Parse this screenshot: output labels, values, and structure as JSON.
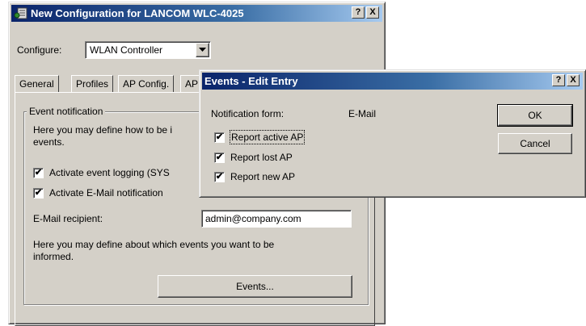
{
  "main_window": {
    "title": "New Configuration for LANCOM WLC-4025",
    "help_btn": "?",
    "close_btn": "X",
    "configure_label": "Configure:",
    "configure_value": "WLAN Controller",
    "tabs": [
      {
        "label": "General"
      },
      {
        "label": "Profiles"
      },
      {
        "label": "AP Config."
      },
      {
        "label": "AP"
      }
    ],
    "group_title": "Event notification",
    "desc1_line1": "Here you may define how to be i",
    "desc1_line2": "events.",
    "checkboxes": [
      {
        "label": "Activate event logging (SYS",
        "checked": true
      },
      {
        "label": "Activate E-Mail notification",
        "checked": true
      }
    ],
    "email_label": "E-Mail recipient:",
    "email_value": "admin@company.com",
    "desc2_line1": "Here you may define about which events you want to be",
    "desc2_line2": "informed.",
    "events_button": "Events..."
  },
  "dialog": {
    "title": "Events - Edit Entry",
    "help_btn": "?",
    "close_btn": "X",
    "notification_label": "Notification form:",
    "notification_value": "E-Mail",
    "checkboxes": [
      {
        "label": "Report active AP",
        "checked": true
      },
      {
        "label": "Report lost AP",
        "checked": true
      },
      {
        "label": "Report new AP",
        "checked": true
      }
    ],
    "ok_button": "OK",
    "cancel_button": "Cancel"
  },
  "check_glyph": "✔"
}
